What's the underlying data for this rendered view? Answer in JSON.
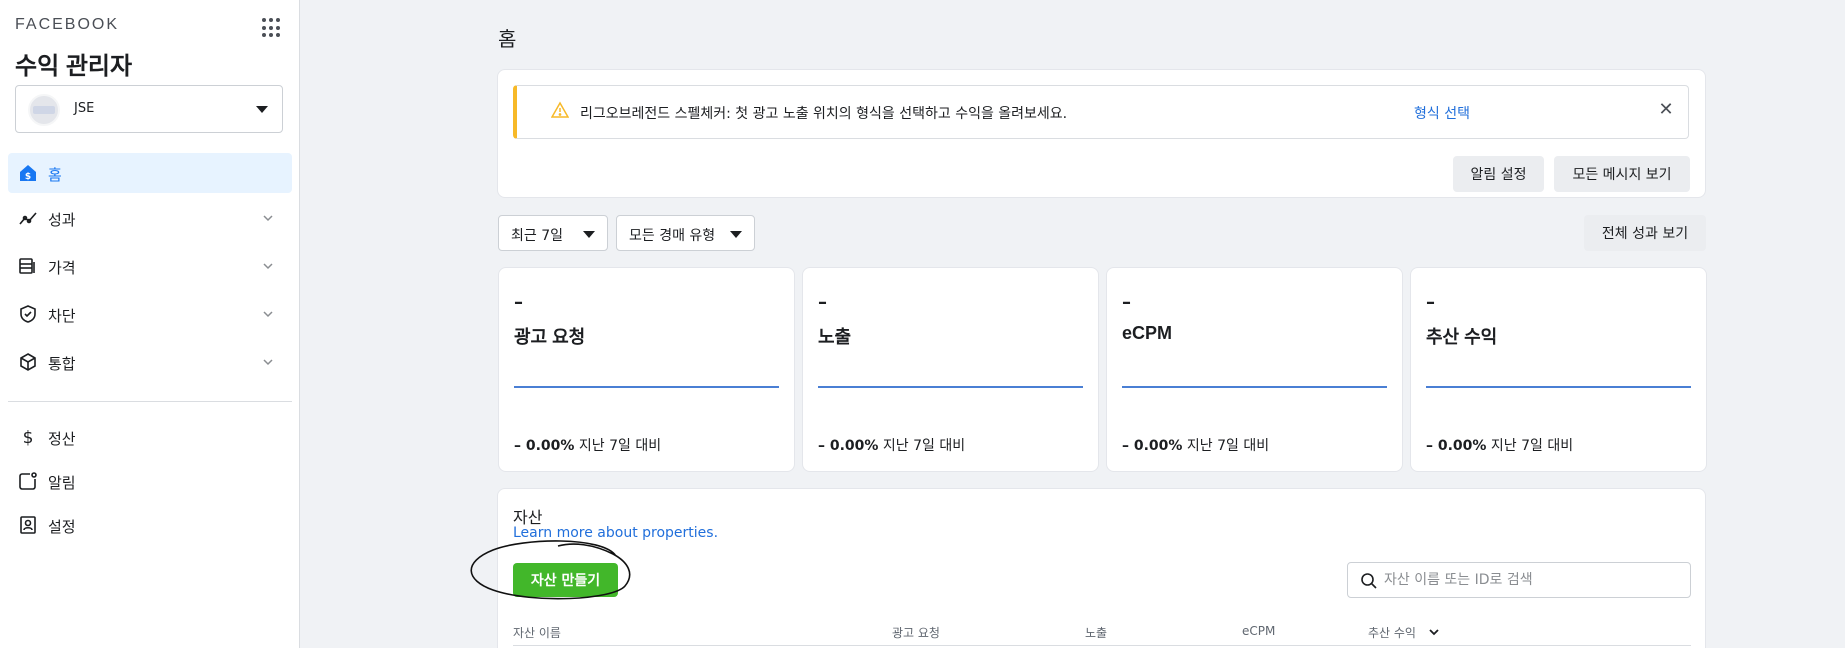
{
  "sidebar": {
    "brand": "FACEBOOK",
    "app_title": "수익 관리자",
    "account_name": "JSE",
    "items": [
      {
        "label": "홈",
        "icon": "home-dollar-icon"
      },
      {
        "label": "성과",
        "icon": "chart-line-icon"
      },
      {
        "label": "가격",
        "icon": "layers-icon"
      },
      {
        "label": "차단",
        "icon": "shield-check-icon"
      },
      {
        "label": "통합",
        "icon": "cube-icon"
      },
      {
        "label": "정산",
        "icon": "dollar-icon"
      },
      {
        "label": "알림",
        "icon": "notification-icon"
      },
      {
        "label": "설정",
        "icon": "settings-person-icon"
      }
    ]
  },
  "main": {
    "page_title": "홈",
    "alert": {
      "message": "리그오브레전드 스펠체커: 첫 광고 노출 위치의 형식을 선택하고 수익을 올려보세요.",
      "link": "형식 선택",
      "close": "✕"
    },
    "notice_buttons": {
      "notification_settings": "알림 설정",
      "view_all_messages": "모든 메시지 보기"
    },
    "filters": {
      "date_range": "최근 7일",
      "auction_type": "모든 경매 유형",
      "view_all_performance": "전체 성과 보기"
    },
    "metrics": [
      {
        "value": "–",
        "label": "광고 요청",
        "change": "– 0.00%",
        "compare": "지난 7일 대비"
      },
      {
        "value": "–",
        "label": "노출",
        "change": "– 0.00%",
        "compare": "지난 7일 대비"
      },
      {
        "value": "–",
        "label": "eCPM",
        "change": "– 0.00%",
        "compare": "지난 7일 대비"
      },
      {
        "value": "–",
        "label": "추산 수익",
        "change": "– 0.00%",
        "compare": "지난 7일 대비"
      }
    ],
    "assets": {
      "title": "자산",
      "learn_more": "Learn more about properties.",
      "create_button": "자산 만들기",
      "search_placeholder": "자산 이름 또는 ID로 검색",
      "columns": [
        "자산 이름",
        "광고 요청",
        "노출",
        "eCPM",
        "추산 수익"
      ]
    }
  },
  "colors": {
    "accent": "#1877f2",
    "link": "#216fdb",
    "create_green": "#42b72a",
    "warning": "#f7b928",
    "metric_line": "#4a7fd4"
  }
}
